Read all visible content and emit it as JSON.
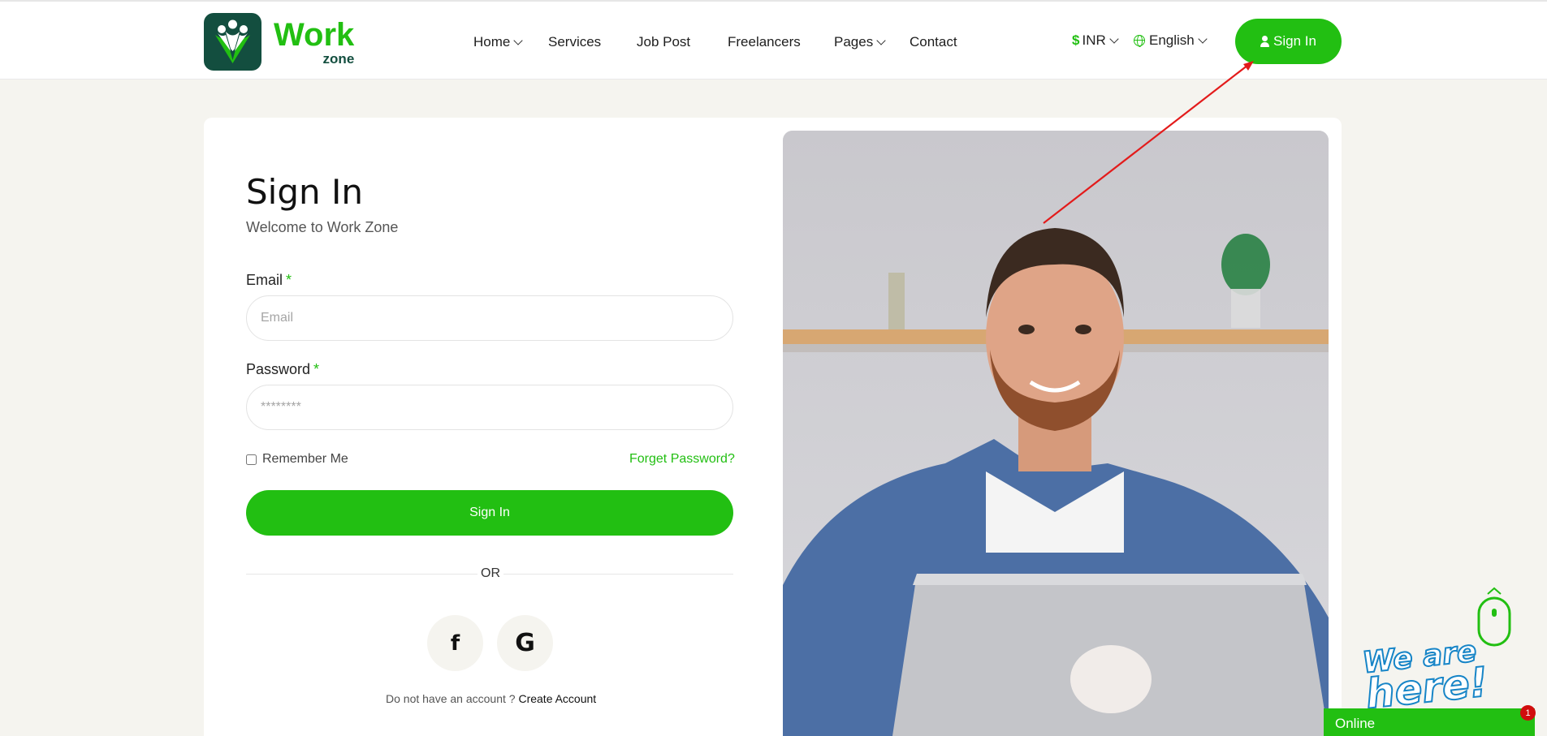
{
  "brand": {
    "name_main": "Work",
    "name_sub": "zone"
  },
  "nav": {
    "items": [
      {
        "label": "Home",
        "has_dropdown": true
      },
      {
        "label": "Services",
        "has_dropdown": false
      },
      {
        "label": "Job Post",
        "has_dropdown": false
      },
      {
        "label": "Freelancers",
        "has_dropdown": false
      },
      {
        "label": "Pages",
        "has_dropdown": true
      },
      {
        "label": "Contact",
        "has_dropdown": false
      }
    ],
    "currency": {
      "symbol": "$",
      "label": "INR"
    },
    "language": {
      "label": "English"
    },
    "signin_label": "Sign In"
  },
  "form": {
    "title": "Sign In",
    "subtitle": "Welcome to Work Zone",
    "email": {
      "label": "Email",
      "required_mark": "*",
      "placeholder": "Email",
      "value": ""
    },
    "password": {
      "label": "Password",
      "required_mark": "*",
      "placeholder": "********",
      "value": ""
    },
    "remember_label": "Remember Me",
    "remember_checked": false,
    "forget_label": "Forget Password?",
    "submit_label": "Sign In",
    "divider_label": "OR",
    "social": [
      {
        "icon": "facebook-icon",
        "glyph": "f"
      },
      {
        "icon": "google-icon",
        "glyph": "G"
      }
    ],
    "no_account_text": "Do not have an account ?",
    "create_account_label": "Create Account"
  },
  "widgets": {
    "chat_tagline_1": "We are",
    "chat_tagline_2": "here!",
    "chat_status": "Online",
    "chat_badge_count": "1"
  },
  "colors": {
    "accent": "#22bf12",
    "brand_dark": "#134e3f",
    "page_bg": "#f5f4ef",
    "annotation_arrow": "#e31b1b",
    "badge": "#d10d0d"
  }
}
